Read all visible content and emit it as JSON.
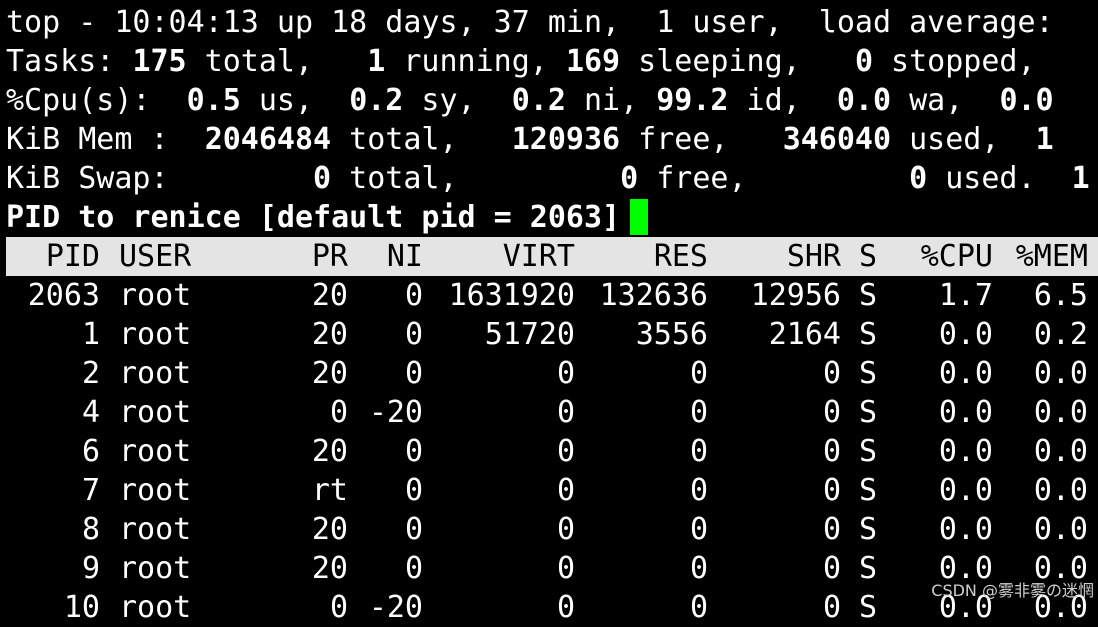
{
  "summary": {
    "line1": "top - 10:04:13 up 18 days, 37 min,  1 user,  load average:",
    "tasks": {
      "label": "Tasks: ",
      "total": "175",
      "total_label": " total,   ",
      "running": "1",
      "running_label": " running, ",
      "sleeping": "169",
      "sleeping_label": " sleeping,   ",
      "stopped": "0",
      "stopped_label": " stopped,"
    },
    "cpu": {
      "label": "%Cpu(s):  ",
      "us": "0.5",
      "us_label": " us,  ",
      "sy": "0.2",
      "sy_label": " sy,  ",
      "ni": "0.2",
      "ni_label": " ni, ",
      "id": "99.2",
      "id_label": " id,  ",
      "wa": "0.0",
      "wa_label": " wa,  ",
      "hi": "0.0"
    },
    "mem": {
      "label": "KiB Mem :  ",
      "total": "2046484",
      "total_label": " total,   ",
      "free": "120936",
      "free_label": " free,   ",
      "used": "346040",
      "used_label": " used,  ",
      "rest": "1"
    },
    "swap": {
      "label": "KiB Swap:        ",
      "total": "0",
      "total_label": " total,         ",
      "free": "0",
      "free_label": " free,         ",
      "used": "0",
      "used_label": " used.  ",
      "rest": "1"
    },
    "prompt": "PID to renice [default pid = 2063]"
  },
  "table": {
    "headers": [
      "PID",
      "USER",
      "PR",
      "NI",
      "VIRT",
      "RES",
      "SHR",
      "S",
      "%CPU",
      "%MEM"
    ],
    "rows": [
      [
        "2063",
        "root",
        "20",
        "0",
        "1631920",
        "132636",
        "12956",
        "S",
        "1.7",
        "6.5"
      ],
      [
        "1",
        "root",
        "20",
        "0",
        "51720",
        "3556",
        "2164",
        "S",
        "0.0",
        "0.2"
      ],
      [
        "2",
        "root",
        "20",
        "0",
        "0",
        "0",
        "0",
        "S",
        "0.0",
        "0.0"
      ],
      [
        "4",
        "root",
        "0",
        "-20",
        "0",
        "0",
        "0",
        "S",
        "0.0",
        "0.0"
      ],
      [
        "6",
        "root",
        "20",
        "0",
        "0",
        "0",
        "0",
        "S",
        "0.0",
        "0.0"
      ],
      [
        "7",
        "root",
        "rt",
        "0",
        "0",
        "0",
        "0",
        "S",
        "0.0",
        "0.0"
      ],
      [
        "8",
        "root",
        "20",
        "0",
        "0",
        "0",
        "0",
        "S",
        "0.0",
        "0.0"
      ],
      [
        "9",
        "root",
        "20",
        "0",
        "0",
        "0",
        "0",
        "S",
        "0.0",
        "0.0"
      ],
      [
        "10",
        "root",
        "0",
        "-20",
        "0",
        "0",
        "0",
        "S",
        "0.0",
        "0.0"
      ]
    ]
  },
  "watermark": "CSDN @雾非雾の迷惘",
  "colors": {
    "background": "#000000",
    "text": "#ffffff",
    "header_bar": "#e4e4e4",
    "cursor": "#00ff00"
  }
}
